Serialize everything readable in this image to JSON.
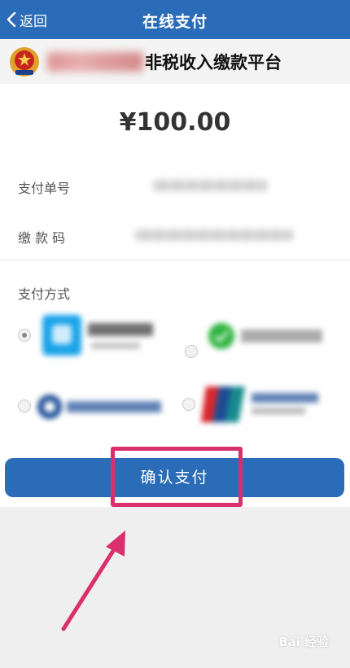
{
  "topbar": {
    "back_label": "返回",
    "title": "在线支付"
  },
  "banner": {
    "platform_name": "非税收入缴款平台"
  },
  "payment": {
    "amount": "¥100.00",
    "order_label": "支付单号",
    "code_label": "缴 款 码",
    "method_label": "支付方式",
    "methods": [
      {
        "icon": "alipay-icon",
        "selected": true
      },
      {
        "icon": "wechat-pay-icon",
        "selected": false
      },
      {
        "icon": "ccb-icon",
        "selected": false
      },
      {
        "icon": "unionpay-icon",
        "selected": false
      }
    ]
  },
  "confirm_label": "确认支付",
  "watermark": "Bai 经验",
  "colors": {
    "primary": "#2a6cb7",
    "highlight": "#d9306d"
  }
}
